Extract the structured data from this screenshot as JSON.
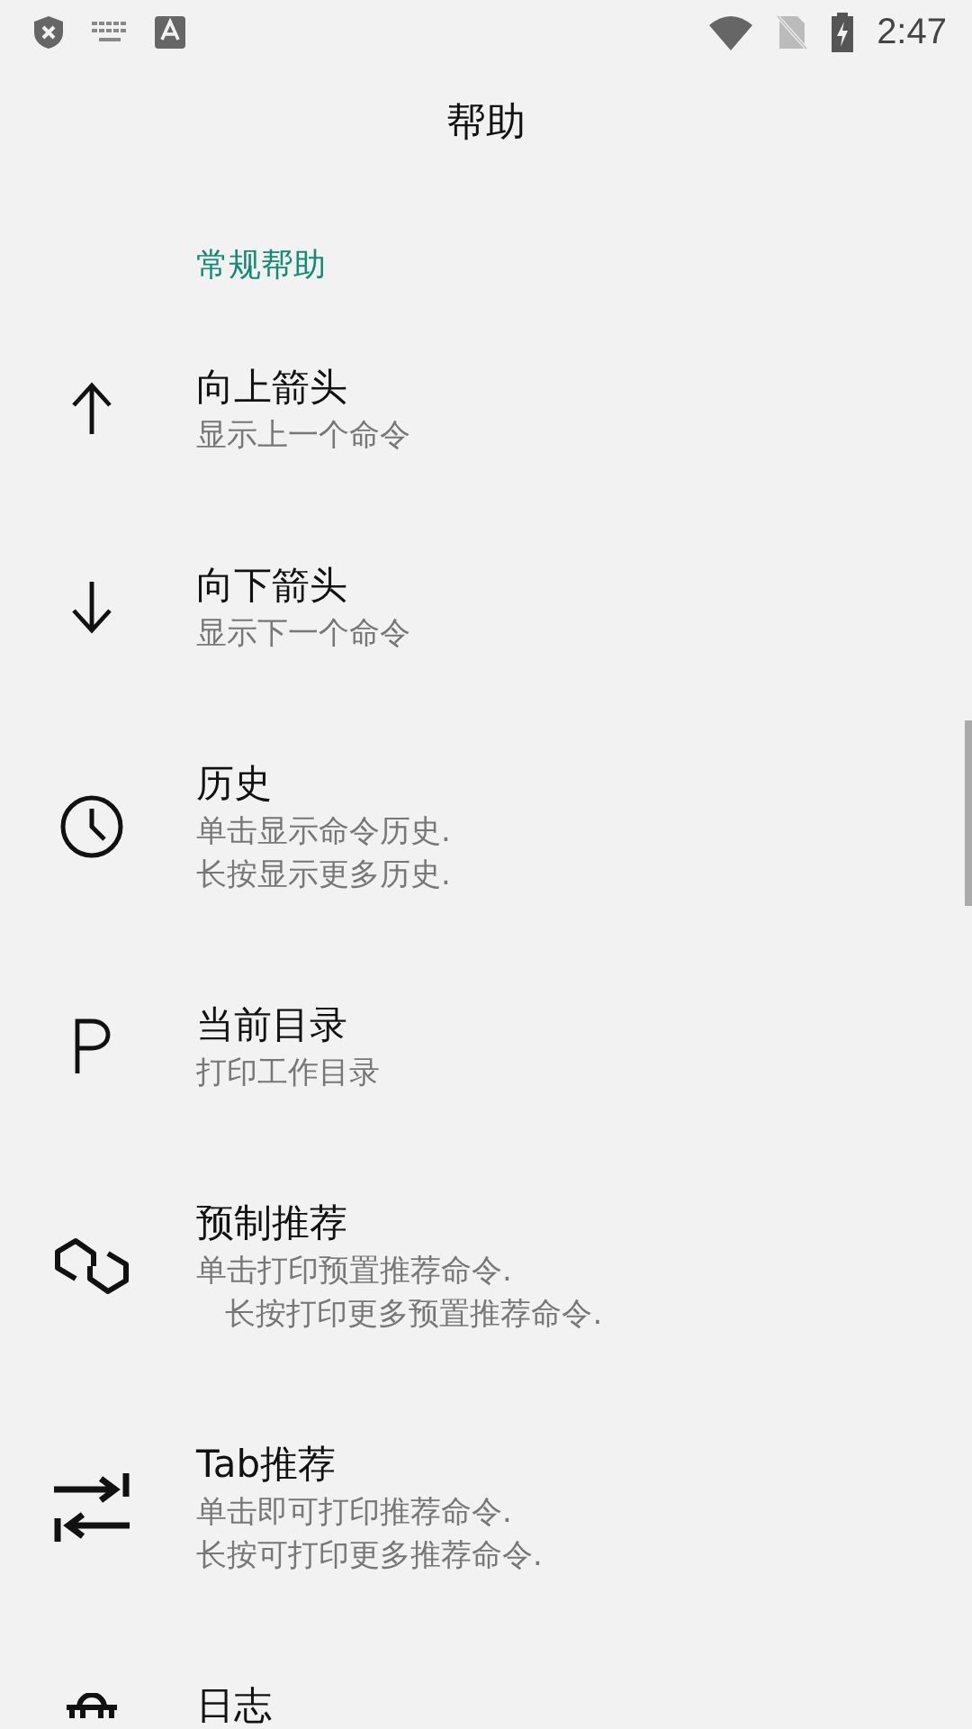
{
  "status_bar": {
    "time": "2:47"
  },
  "title": "帮助",
  "section": "常规帮助",
  "items": [
    {
      "title": "向上箭头",
      "description": [
        "显示上一个命令"
      ]
    },
    {
      "title": "向下箭头",
      "description": [
        "显示下一个命令"
      ]
    },
    {
      "title": "历史",
      "description": [
        "单击显示命令历史.",
        "长按显示更多历史."
      ]
    },
    {
      "title": "当前目录",
      "description": [
        "打印工作目录"
      ]
    },
    {
      "title": "预制推荐",
      "description": [
        "单击打印预置推荐命令.",
        "   长按打印更多预置推荐命令."
      ]
    },
    {
      "title": "Tab推荐",
      "description": [
        "单击即可打印推荐命令.",
        "长按可打印更多推荐命令."
      ]
    },
    {
      "title": "日志"
    }
  ]
}
